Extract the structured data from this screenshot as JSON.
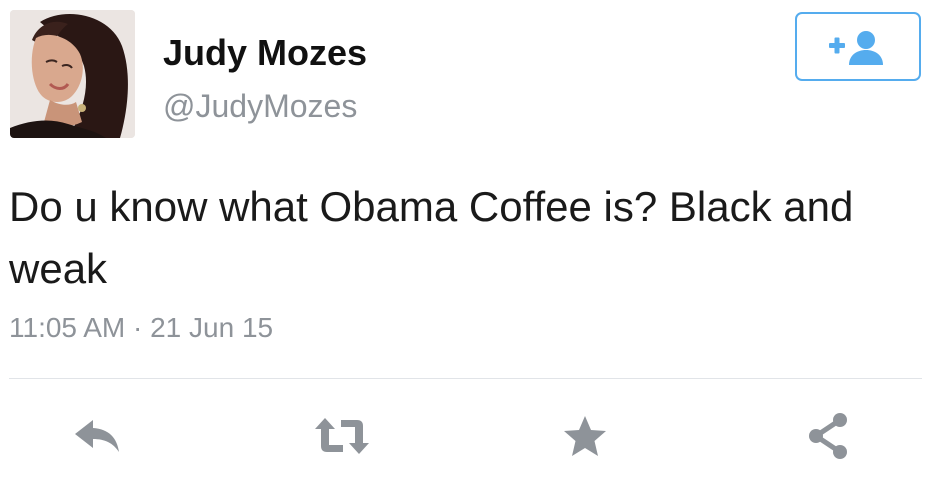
{
  "tweet": {
    "display_name": "Judy Mozes",
    "screen_name": "@JudyMozes",
    "text": "Do u know what Obama Coffee is? Black and weak",
    "timestamp": "11:05 AM · 21 Jun 15"
  },
  "icons": {
    "follow": "add-user-icon",
    "reply": "reply-icon",
    "retweet": "retweet-icon",
    "favorite": "star-icon",
    "share": "share-icon"
  },
  "colors": {
    "accent": "#55acee",
    "icon_gray": "#8e9399",
    "text": "#1a1a1a",
    "muted": "#8e9399"
  }
}
